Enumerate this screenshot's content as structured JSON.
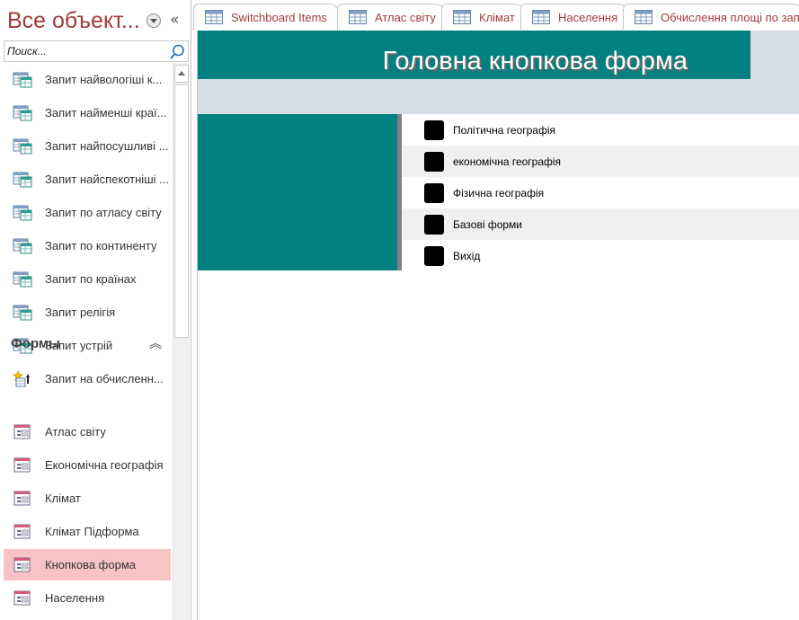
{
  "navigation": {
    "title": "Все объект...",
    "search_placeholder": "Поиск...",
    "queries": [
      {
        "label": "Запит найвологіші к...",
        "icon": "query-icon"
      },
      {
        "label": "Запит найменші краї...",
        "icon": "query-icon"
      },
      {
        "label": "Запит найпосушливі ...",
        "icon": "query-icon"
      },
      {
        "label": "Запит найспекотніші ...",
        "icon": "query-icon"
      },
      {
        "label": "Запит по атласу світу",
        "icon": "query-icon"
      },
      {
        "label": "Запит по континенту",
        "icon": "query-icon"
      },
      {
        "label": "Запит по країнах",
        "icon": "query-icon"
      },
      {
        "label": "Запит релігія",
        "icon": "query-icon"
      },
      {
        "label": "Запит устрій",
        "icon": "query-icon"
      },
      {
        "label": "Запит на обчисленн...",
        "icon": "make-table-query-icon"
      }
    ],
    "forms_section": {
      "label": "Формы",
      "items": [
        {
          "label": "Атлас світу",
          "icon": "form-icon"
        },
        {
          "label": "Економічна географія",
          "icon": "form-icon"
        },
        {
          "label": "Клімат",
          "icon": "form-icon"
        },
        {
          "label": "Клімат Підформа",
          "icon": "form-icon"
        },
        {
          "label": "Кнопкова форма",
          "icon": "form-icon",
          "selected": true
        },
        {
          "label": "Населення",
          "icon": "form-icon"
        }
      ]
    }
  },
  "tabs": [
    {
      "label": "Switchboard Items",
      "icon": "table-icon"
    },
    {
      "label": "Атлас світу",
      "icon": "table-icon"
    },
    {
      "label": "Клімат",
      "icon": "table-icon"
    },
    {
      "label": "Населення",
      "icon": "table-icon"
    },
    {
      "label": "Обчислення площі по запи",
      "icon": "table-icon"
    }
  ],
  "form": {
    "title": "Головна кнопкова форма",
    "buttons": [
      {
        "label": "Політична географія"
      },
      {
        "label": "економічна географія"
      },
      {
        "label": "Фізична географія"
      },
      {
        "label": "Базові форми"
      },
      {
        "label": "Вихід"
      }
    ]
  },
  "colors": {
    "accent_teal": "#008080",
    "header_bg": "#d5dce5",
    "nav_title": "#a33a3a",
    "selected_item": "#f7c3c5"
  }
}
